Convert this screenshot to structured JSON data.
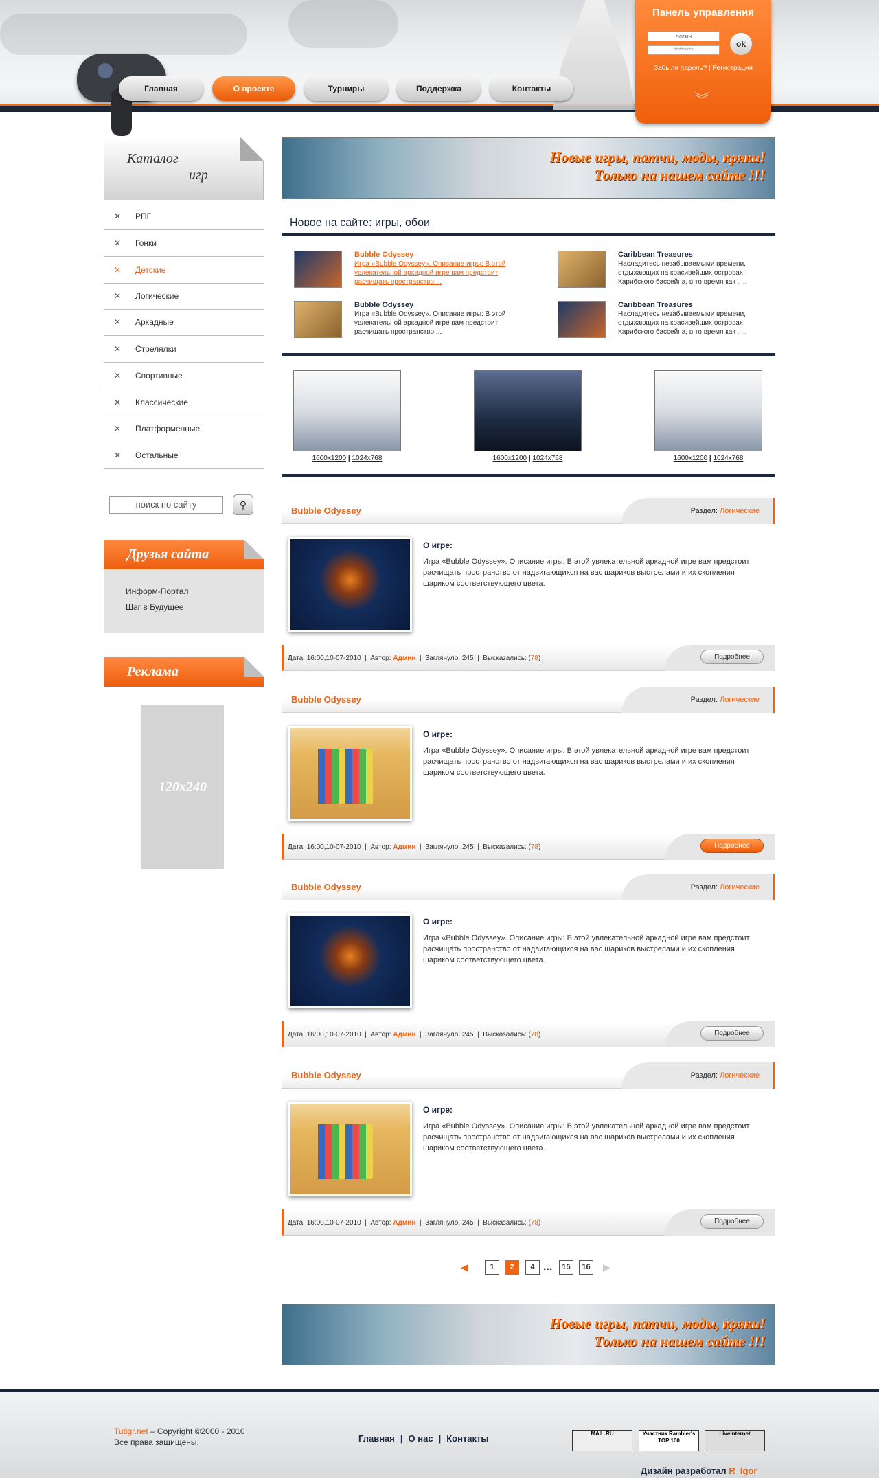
{
  "nav": [
    "Главная",
    "О проекте",
    "Турниры",
    "Поддержка",
    "Контакты"
  ],
  "panel": {
    "title": "Панель управления",
    "login_ph": "логин",
    "pass_ph": "********",
    "ok": "ok",
    "forgot": "Забыли пароль?",
    "sep": " | ",
    "register": "Регистрация"
  },
  "catalog": {
    "title1": "Каталог",
    "title2": "игр",
    "items": [
      "РПГ",
      "Гонки",
      "Детские",
      "Логические",
      "Аркадные",
      "Стрелялки",
      "Спортивные",
      "Классические",
      "Платформенные",
      "Остальные"
    ]
  },
  "search_placeholder": "поиск по сайту",
  "friends": {
    "title": "Друзья сайта",
    "items": [
      "Информ-Портал",
      "Шаг в Будущее"
    ]
  },
  "ads": {
    "title": "Реклама",
    "placeholder": "120x240"
  },
  "banner": {
    "line1": "Новые игры, патчи, моды, кряки!",
    "line2": "Только на нашем сайте !!!"
  },
  "new_section_title": "Новое на сайте: игры, обои",
  "news": [
    {
      "title": "Bubble Odyssey",
      "text": "Игра «Bubble Odyssey». Описание игры: В этой увлекательной аркадной игре вам предстоит расчищать пространство...."
    },
    {
      "title": "Caribbean Treasures",
      "text": "Насладитесь незабываемыми времени, отдыхающих на красивейших островах Карибского бассейна, в то время как ....."
    },
    {
      "title": "Bubble Odyssey",
      "text": "Игра «Bubble Odyssey». Описание игры: В этой увлекательной аркадной игре вам предстоит расчищать пространство...."
    },
    {
      "title": "Caribbean Treasures",
      "text": "Насладитесь незабываемыми времени, отдыхающих на красивейших островах Карибского бассейна, в то время как ....."
    }
  ],
  "wallpapers": [
    {
      "r1": "1600x1200",
      "r2": "1024x768",
      "sep": "|"
    },
    {
      "r1": "1600x1200",
      "r2": "1024x768",
      "sep": "|"
    },
    {
      "r1": "1600x1200",
      "r2": "1024x768",
      "sep": "|"
    }
  ],
  "post_common": {
    "section_label": "Раздел:",
    "section": "Логические",
    "about": "О игре:",
    "desc": "Игра «Bubble Odyssey». Описание игры: В этой увлекательной аркадной игре вам предстоит расчищать пространство от надвигающихся на вас шариков выстрелами и их скопления шариком соответствующего цвета.",
    "date_label": "Дата:",
    "date": "16:00,10-07-2010",
    "author_label": "Автор:",
    "author": "Админ",
    "views_label": "Заглянуло:",
    "views": "245",
    "comments_label": "Высказались:",
    "comments": "78",
    "more": "Подробнее"
  },
  "posts": [
    {
      "title": "Bubble Odyssey"
    },
    {
      "title": "Bubble Odyssey"
    },
    {
      "title": "Bubble Odyssey"
    },
    {
      "title": "Bubble Odyssey"
    }
  ],
  "pagination": {
    "pages": [
      "1",
      "2",
      "4",
      "15",
      "16"
    ],
    "ellipsis": "...",
    "current": "2"
  },
  "footer": {
    "site": "Tutigr.net",
    "copyright": " – Copyright ©2000 - 2010",
    "rights": "Все права защищены.",
    "nav": [
      "Главная",
      "О нас",
      "Контакты"
    ],
    "sep": "|",
    "counter1": "MAIL.RU",
    "counter2": "Участник Rambler's TOP 100",
    "counter3": "LiveInternet",
    "design_label": "Дизайн разработал ",
    "designer": "R_Igor"
  },
  "colors": {
    "accent": "#f06413",
    "dark": "#1c2740"
  }
}
